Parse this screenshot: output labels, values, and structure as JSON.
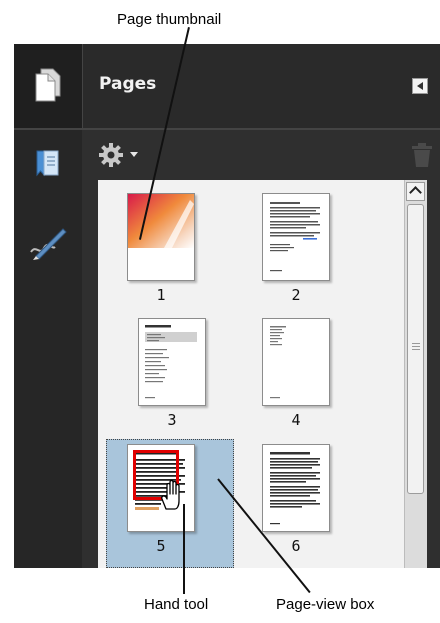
{
  "callouts": {
    "page_thumbnail": "Page thumbnail",
    "hand_tool": "Hand tool",
    "page_view_box": "Page-view box"
  },
  "panel": {
    "title": "Pages",
    "header_icon": "page-icon",
    "collapse_icon": "collapse-arrow-icon",
    "sidebar_icons": [
      "bookmark-icon",
      "signature-pen-icon"
    ],
    "toolbar_icons": [
      "gear-options-icon",
      "trash-icon"
    ],
    "accent_colors": {
      "panel_bg": "#2f2f2f",
      "selection": "#a9c5db",
      "page_view_box": "#e00000"
    }
  },
  "thumbnails": [
    {
      "label": "1"
    },
    {
      "label": "2"
    },
    {
      "label": "3"
    },
    {
      "label": "4"
    },
    {
      "label": "5",
      "selected": true
    },
    {
      "label": "6"
    }
  ]
}
